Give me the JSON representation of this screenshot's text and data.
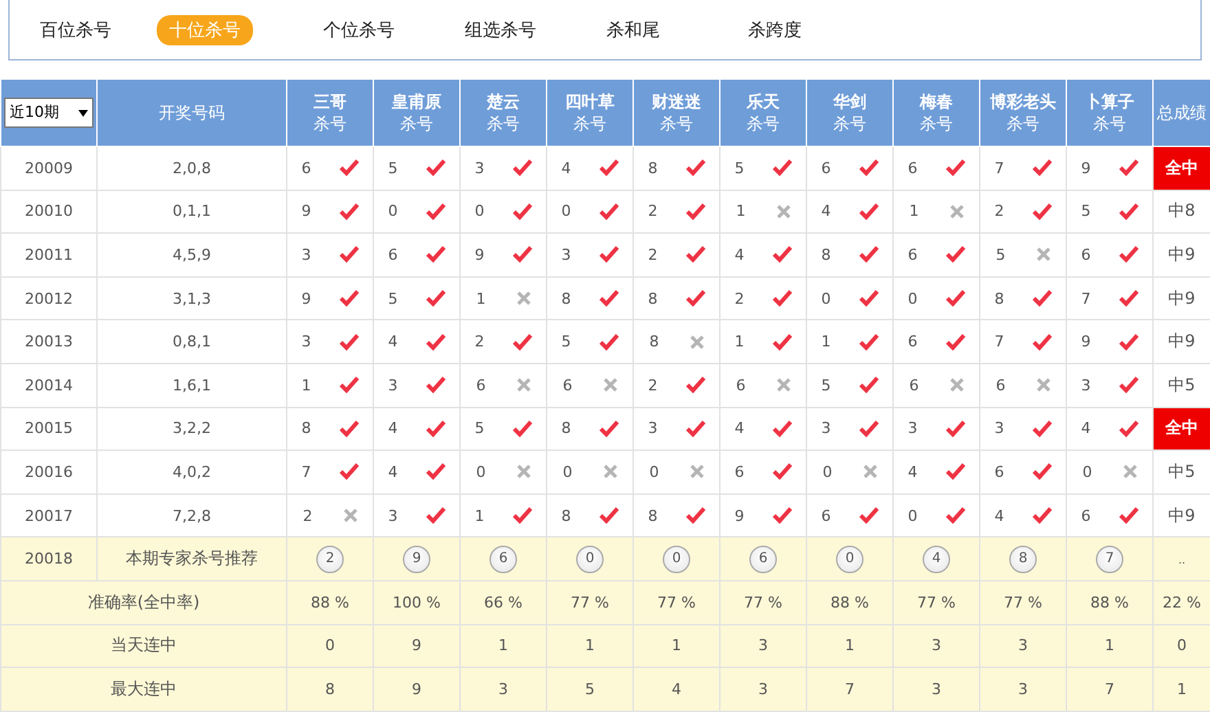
{
  "nav": [
    {
      "label": "百位杀号",
      "selected": false
    },
    {
      "label": "十位杀号",
      "selected": true
    },
    {
      "label": "个位杀号",
      "selected": false
    },
    {
      "label": "组选杀号",
      "selected": false
    },
    {
      "label": "杀和尾",
      "selected": false
    },
    {
      "label": "杀跨度",
      "selected": false
    }
  ],
  "table": {
    "period_select": "近10期",
    "draw_heading": "开奖号码",
    "experts": [
      {
        "name": "三哥",
        "sub": "杀号"
      },
      {
        "name": "皇甫原",
        "sub": "杀号"
      },
      {
        "name": "楚云",
        "sub": "杀号"
      },
      {
        "name": "四叶草",
        "sub": "杀号"
      },
      {
        "name": "财迷迷",
        "sub": "杀号"
      },
      {
        "name": "乐天",
        "sub": "杀号"
      },
      {
        "name": "华剑",
        "sub": "杀号"
      },
      {
        "name": "梅春",
        "sub": "杀号"
      },
      {
        "name": "博彩老头",
        "sub": "杀号"
      },
      {
        "name": "卜算子",
        "sub": "杀号"
      }
    ],
    "total_heading": "总成绩",
    "rows": [
      {
        "period": "20009",
        "draw": "2,0,8",
        "picks": [
          {
            "num": "6",
            "hit": true
          },
          {
            "num": "5",
            "hit": true
          },
          {
            "num": "3",
            "hit": true
          },
          {
            "num": "4",
            "hit": true
          },
          {
            "num": "8",
            "hit": true
          },
          {
            "num": "5",
            "hit": true
          },
          {
            "num": "6",
            "hit": true
          },
          {
            "num": "6",
            "hit": true
          },
          {
            "num": "7",
            "hit": true
          },
          {
            "num": "9",
            "hit": true
          }
        ],
        "total": "全中",
        "full": true
      },
      {
        "period": "20010",
        "draw": "0,1,1",
        "picks": [
          {
            "num": "9",
            "hit": true
          },
          {
            "num": "0",
            "hit": true
          },
          {
            "num": "0",
            "hit": true
          },
          {
            "num": "0",
            "hit": true
          },
          {
            "num": "2",
            "hit": true
          },
          {
            "num": "1",
            "hit": false
          },
          {
            "num": "4",
            "hit": true
          },
          {
            "num": "1",
            "hit": false
          },
          {
            "num": "2",
            "hit": true
          },
          {
            "num": "5",
            "hit": true
          }
        ],
        "total": "中8",
        "full": false
      },
      {
        "period": "20011",
        "draw": "4,5,9",
        "picks": [
          {
            "num": "3",
            "hit": true
          },
          {
            "num": "6",
            "hit": true
          },
          {
            "num": "9",
            "hit": true
          },
          {
            "num": "3",
            "hit": true
          },
          {
            "num": "2",
            "hit": true
          },
          {
            "num": "4",
            "hit": true
          },
          {
            "num": "8",
            "hit": true
          },
          {
            "num": "6",
            "hit": true
          },
          {
            "num": "5",
            "hit": false
          },
          {
            "num": "6",
            "hit": true
          }
        ],
        "total": "中9",
        "full": false
      },
      {
        "period": "20012",
        "draw": "3,1,3",
        "picks": [
          {
            "num": "9",
            "hit": true
          },
          {
            "num": "5",
            "hit": true
          },
          {
            "num": "1",
            "hit": false
          },
          {
            "num": "8",
            "hit": true
          },
          {
            "num": "8",
            "hit": true
          },
          {
            "num": "2",
            "hit": true
          },
          {
            "num": "0",
            "hit": true
          },
          {
            "num": "0",
            "hit": true
          },
          {
            "num": "8",
            "hit": true
          },
          {
            "num": "7",
            "hit": true
          }
        ],
        "total": "中9",
        "full": false
      },
      {
        "period": "20013",
        "draw": "0,8,1",
        "picks": [
          {
            "num": "3",
            "hit": true
          },
          {
            "num": "4",
            "hit": true
          },
          {
            "num": "2",
            "hit": true
          },
          {
            "num": "5",
            "hit": true
          },
          {
            "num": "8",
            "hit": false
          },
          {
            "num": "1",
            "hit": true
          },
          {
            "num": "1",
            "hit": true
          },
          {
            "num": "6",
            "hit": true
          },
          {
            "num": "7",
            "hit": true
          },
          {
            "num": "9",
            "hit": true
          }
        ],
        "total": "中9",
        "full": false
      },
      {
        "period": "20014",
        "draw": "1,6,1",
        "picks": [
          {
            "num": "1",
            "hit": true
          },
          {
            "num": "3",
            "hit": true
          },
          {
            "num": "6",
            "hit": false
          },
          {
            "num": "6",
            "hit": false
          },
          {
            "num": "2",
            "hit": true
          },
          {
            "num": "6",
            "hit": false
          },
          {
            "num": "5",
            "hit": true
          },
          {
            "num": "6",
            "hit": false
          },
          {
            "num": "6",
            "hit": false
          },
          {
            "num": "3",
            "hit": true
          }
        ],
        "total": "中5",
        "full": false
      },
      {
        "period": "20015",
        "draw": "3,2,2",
        "picks": [
          {
            "num": "8",
            "hit": true
          },
          {
            "num": "4",
            "hit": true
          },
          {
            "num": "5",
            "hit": true
          },
          {
            "num": "8",
            "hit": true
          },
          {
            "num": "3",
            "hit": true
          },
          {
            "num": "4",
            "hit": true
          },
          {
            "num": "3",
            "hit": true
          },
          {
            "num": "3",
            "hit": true
          },
          {
            "num": "3",
            "hit": true
          },
          {
            "num": "4",
            "hit": true
          }
        ],
        "total": "全中",
        "full": true
      },
      {
        "period": "20016",
        "draw": "4,0,2",
        "picks": [
          {
            "num": "7",
            "hit": true
          },
          {
            "num": "4",
            "hit": true
          },
          {
            "num": "0",
            "hit": false
          },
          {
            "num": "0",
            "hit": false
          },
          {
            "num": "0",
            "hit": false
          },
          {
            "num": "6",
            "hit": true
          },
          {
            "num": "0",
            "hit": false
          },
          {
            "num": "4",
            "hit": true
          },
          {
            "num": "6",
            "hit": true
          },
          {
            "num": "0",
            "hit": false
          }
        ],
        "total": "中5",
        "full": false
      },
      {
        "period": "20017",
        "draw": "7,2,8",
        "picks": [
          {
            "num": "2",
            "hit": false
          },
          {
            "num": "3",
            "hit": true
          },
          {
            "num": "1",
            "hit": true
          },
          {
            "num": "8",
            "hit": true
          },
          {
            "num": "8",
            "hit": true
          },
          {
            "num": "9",
            "hit": true
          },
          {
            "num": "6",
            "hit": true
          },
          {
            "num": "0",
            "hit": true
          },
          {
            "num": "4",
            "hit": true
          },
          {
            "num": "6",
            "hit": true
          }
        ],
        "total": "中9",
        "full": false
      }
    ],
    "recommendation": {
      "period": "20018",
      "label": "本期专家杀号推荐",
      "picks": [
        "2",
        "9",
        "6",
        "0",
        "0",
        "6",
        "0",
        "4",
        "8",
        "7"
      ],
      "total": ".."
    },
    "stats": [
      {
        "label": "准确率(全中率)",
        "values": [
          "88 %",
          "100 %",
          "66 %",
          "77 %",
          "77 %",
          "77 %",
          "88 %",
          "77 %",
          "77 %",
          "88 %"
        ],
        "total": "22 %"
      },
      {
        "label": "当天连中",
        "values": [
          "0",
          "9",
          "1",
          "1",
          "1",
          "3",
          "1",
          "3",
          "3",
          "1"
        ],
        "total": "0"
      },
      {
        "label": "最大连中",
        "values": [
          "8",
          "9",
          "3",
          "5",
          "4",
          "3",
          "7",
          "3",
          "3",
          "7"
        ],
        "total": "1"
      }
    ]
  }
}
